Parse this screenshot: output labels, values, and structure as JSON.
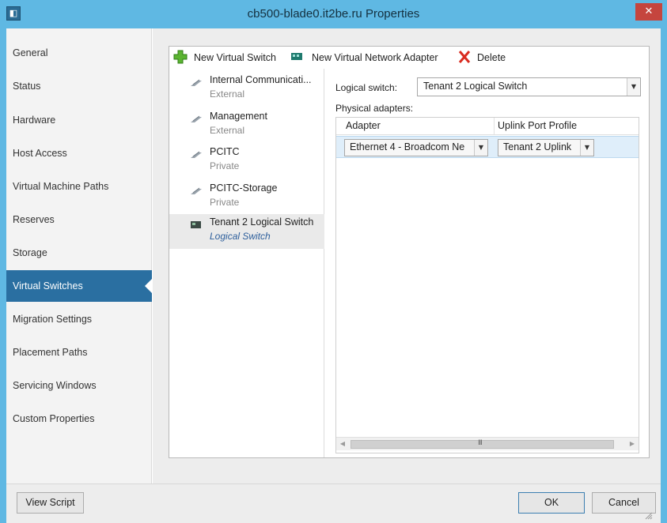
{
  "window": {
    "title": "cb500-blade0.it2be.ru Properties",
    "icon_glyph": "◧",
    "close_glyph": "✕",
    "accent_color": "#5fb8e3",
    "selection_color": "#2a6fa1"
  },
  "sidebar": {
    "items": [
      {
        "label": "General"
      },
      {
        "label": "Status"
      },
      {
        "label": "Hardware"
      },
      {
        "label": "Host Access"
      },
      {
        "label": "Virtual Machine Paths"
      },
      {
        "label": "Reserves"
      },
      {
        "label": "Storage"
      },
      {
        "label": "Virtual Switches"
      },
      {
        "label": "Migration Settings"
      },
      {
        "label": "Placement Paths"
      },
      {
        "label": "Servicing Windows"
      },
      {
        "label": "Custom Properties"
      }
    ],
    "selected_label": "Virtual Switches"
  },
  "toolbar": {
    "new_virtual_switch": "New Virtual Switch",
    "new_virtual_network_adapter": "New Virtual Network Adapter",
    "delete": "Delete",
    "icons": [
      "plus-icon",
      "network-adapter-icon",
      "delete-x-icon"
    ]
  },
  "switches": [
    {
      "name": "Internal Communicati...",
      "type": "External",
      "icon": "switch-icon"
    },
    {
      "name": "Management",
      "type": "External",
      "icon": "switch-icon"
    },
    {
      "name": "PCITC",
      "type": "Private",
      "icon": "switch-icon"
    },
    {
      "name": "PCITC-Storage",
      "type": "Private",
      "icon": "switch-icon"
    },
    {
      "name": "Tenant 2 Logical Switch",
      "type": "Logical Switch",
      "icon": "logical-switch-icon"
    }
  ],
  "detail": {
    "logical_switch_label": "Logical switch:",
    "logical_switch_value": "Tenant 2 Logical Switch",
    "physical_adapters_label": "Physical adapters:",
    "columns": [
      "Adapter",
      "Uplink Port Profile"
    ],
    "rows": [
      {
        "adapter": "Ethernet 4 - Broadcom Ne",
        "uplink": "Tenant 2 Uplink"
      }
    ],
    "scroll_grip": "III"
  },
  "footer": {
    "view_script": "View Script",
    "ok": "OK",
    "cancel": "Cancel"
  }
}
